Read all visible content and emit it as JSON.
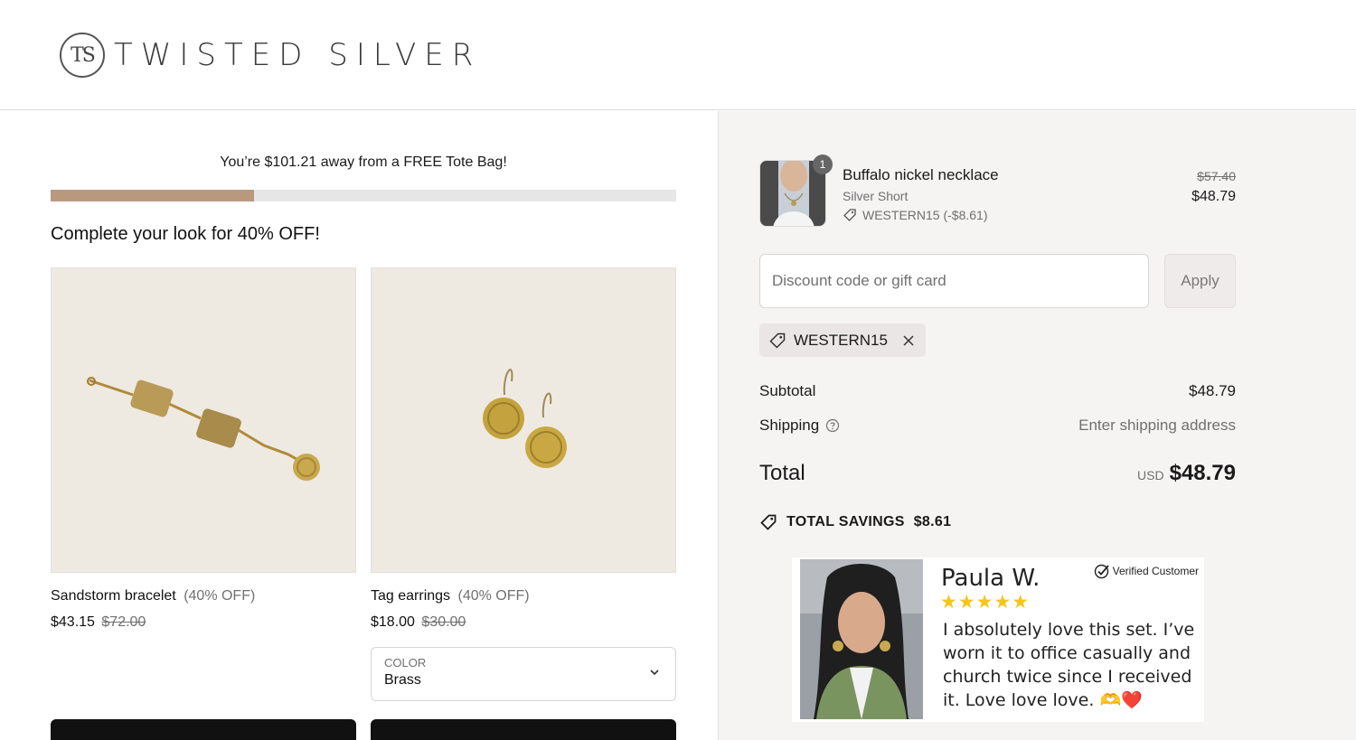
{
  "brand": {
    "mark": "TS",
    "name": "TWISTED SILVER"
  },
  "promo": {
    "message": "You’re $101.21 away from a FREE Tote Bag!",
    "progress_fraction": 0.325
  },
  "upsell": {
    "title": "Complete your look for 40% OFF!",
    "products": [
      {
        "name": "Sandstorm bracelet",
        "discount_label": "(40% OFF)",
        "price": "$43.15",
        "compare_price": "$72.00"
      },
      {
        "name": "Tag earrings",
        "discount_label": "(40% OFF)",
        "price": "$18.00",
        "compare_price": "$30.00",
        "option_label": "COLOR",
        "option_value": "Brass"
      }
    ]
  },
  "cart": {
    "item": {
      "quantity": "1",
      "name": "Buffalo nickel necklace",
      "variant": "Silver Short",
      "discount": "WESTERN15 (-$8.61)",
      "compare_price": "$57.40",
      "price": "$48.79"
    },
    "discount_placeholder": "Discount code or gift card",
    "apply_label": "Apply",
    "applied_code": "WESTERN15",
    "subtotal_label": "Subtotal",
    "subtotal_value": "$48.79",
    "shipping_label": "Shipping",
    "shipping_value": "Enter shipping address",
    "total_label": "Total",
    "total_currency": "USD",
    "total_value": "$48.79",
    "savings_label": "TOTAL SAVINGS",
    "savings_value": "$8.61"
  },
  "review": {
    "name": "Paula W.",
    "stars": "★★★★★",
    "verified_label": "Verified Customer",
    "text": "I absolutely love this set. I’ve worn it to office casually and church twice since I received it. Love love love. 🫶❤️"
  },
  "colors": {
    "accent": "#b8997e",
    "track": "#e6e6e6",
    "sidebar_bg": "#f6f3f3",
    "button_dark": "#111111",
    "star": "#f5c518"
  }
}
